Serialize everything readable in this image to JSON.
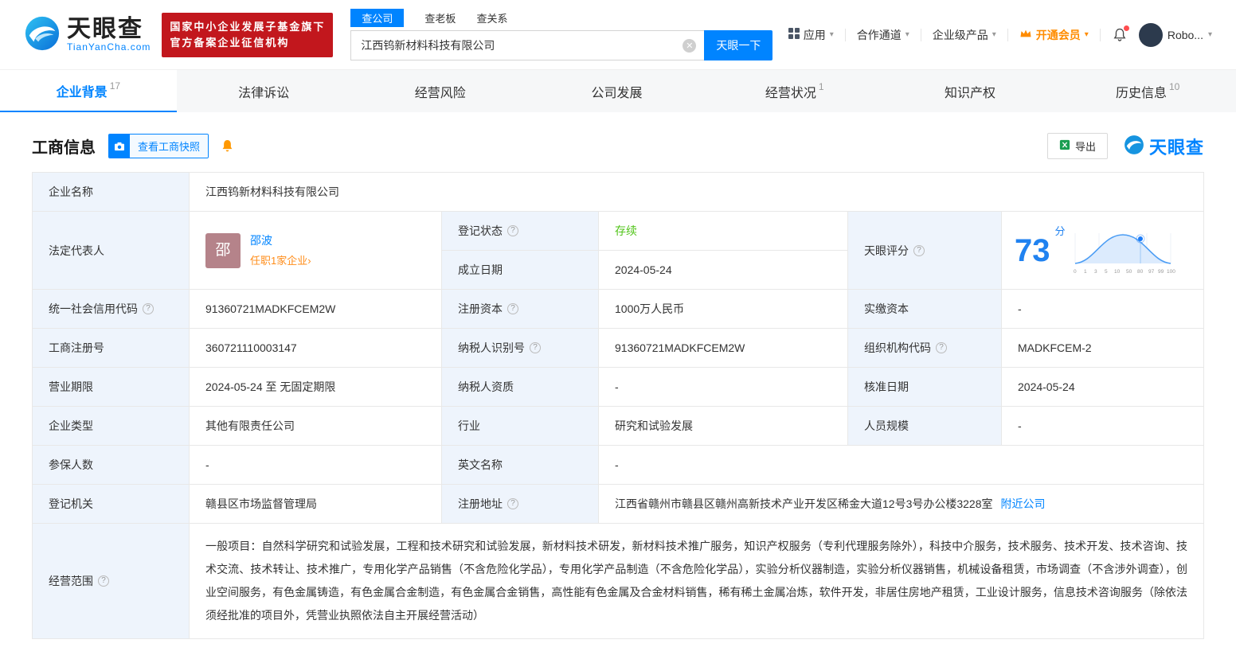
{
  "header": {
    "logo": {
      "brand": "天眼查",
      "domain": "TianYanCha.com"
    },
    "badge": {
      "line1": "国家中小企业发展子基金旗下",
      "line2": "官方备案企业征信机构"
    },
    "search": {
      "tabs": [
        {
          "label": "查公司"
        },
        {
          "label": "查老板"
        },
        {
          "label": "查关系"
        }
      ],
      "value": "江西钨新材料科技有限公司",
      "button": "天眼一下"
    },
    "nav": {
      "apps": "应用",
      "cooperation": "合作通道",
      "enterprise": "企业级产品",
      "vip": "开通会员",
      "user": "Robo..."
    }
  },
  "tabbar": {
    "tabs": [
      {
        "label": "企业背景",
        "count": "17"
      },
      {
        "label": "法律诉讼",
        "count": ""
      },
      {
        "label": "经营风险",
        "count": ""
      },
      {
        "label": "公司发展",
        "count": ""
      },
      {
        "label": "经营状况",
        "count": "1"
      },
      {
        "label": "知识产权",
        "count": ""
      },
      {
        "label": "历史信息",
        "count": "10"
      }
    ]
  },
  "section": {
    "title": "工商信息",
    "snapshot_button": "查看工商快照",
    "export_button": "导出",
    "watermark": "天眼查"
  },
  "score_chart": {
    "score": "73",
    "unit": "分",
    "axis_labels": [
      "0",
      "1",
      "3",
      "5",
      "10",
      "50",
      "80",
      "97",
      "99",
      "100"
    ]
  },
  "fields": {
    "company_name": {
      "label": "企业名称",
      "value": "江西钨新材料科技有限公司"
    },
    "legal_rep": {
      "label": "法定代表人",
      "avatar_text": "邵",
      "name": "邵波",
      "note": "任职1家企业",
      "arrow": "›"
    },
    "reg_status": {
      "label": "登记状态",
      "value": "存续"
    },
    "establish_date": {
      "label": "成立日期",
      "value": "2024-05-24"
    },
    "score": {
      "label": "天眼评分"
    },
    "credit_code": {
      "label": "统一社会信用代码",
      "value": "91360721MADKFCEM2W"
    },
    "reg_capital": {
      "label": "注册资本",
      "value": "1000万人民币"
    },
    "paid_capital": {
      "label": "实缴资本",
      "value": "-"
    },
    "reg_number": {
      "label": "工商注册号",
      "value": "360721110003147"
    },
    "taxpayer_id": {
      "label": "纳税人识别号",
      "value": "91360721MADKFCEM2W"
    },
    "org_code": {
      "label": "组织机构代码",
      "value": "MADKFCEM-2"
    },
    "business_term": {
      "label": "营业期限",
      "value": "2024-05-24 至 无固定期限"
    },
    "taxpayer_quality": {
      "label": "纳税人资质",
      "value": "-"
    },
    "approval_date": {
      "label": "核准日期",
      "value": "2024-05-24"
    },
    "company_type": {
      "label": "企业类型",
      "value": "其他有限责任公司"
    },
    "industry": {
      "label": "行业",
      "value": "研究和试验发展"
    },
    "staff_size": {
      "label": "人员规模",
      "value": "-"
    },
    "insured_count": {
      "label": "参保人数",
      "value": "-"
    },
    "english_name": {
      "label": "英文名称",
      "value": "-"
    },
    "reg_authority": {
      "label": "登记机关",
      "value": "赣县区市场监督管理局"
    },
    "reg_address": {
      "label": "注册地址",
      "value": "江西省赣州市赣县区赣州高新技术产业开发区稀金大道12号3号办公楼3228室",
      "link": "附近公司"
    },
    "business_scope": {
      "label": "经营范围",
      "value": "一般项目：自然科学研究和试验发展，工程和技术研究和试验发展，新材料技术研发，新材料技术推广服务，知识产权服务（专利代理服务除外），科技中介服务，技术服务、技术开发、技术咨询、技术交流、技术转让、技术推广，专用化学产品销售（不含危险化学品），专用化学产品制造（不含危险化学品），实验分析仪器制造，实验分析仪器销售，机械设备租赁，市场调查（不含涉外调查），创业空间服务，有色金属铸造，有色金属合金制造，有色金属合金销售，高性能有色金属及合金材料销售，稀有稀土金属冶炼，软件开发，非居住房地产租赁，工业设计服务，信息技术咨询服务（除依法须经批准的项目外，凭营业执照依法自主开展经营活动）"
    }
  },
  "colors": {
    "accent_blue": "#0084ff",
    "orange": "#ff8c00",
    "green": "#52c41a",
    "badge_red": "#c2171d"
  }
}
